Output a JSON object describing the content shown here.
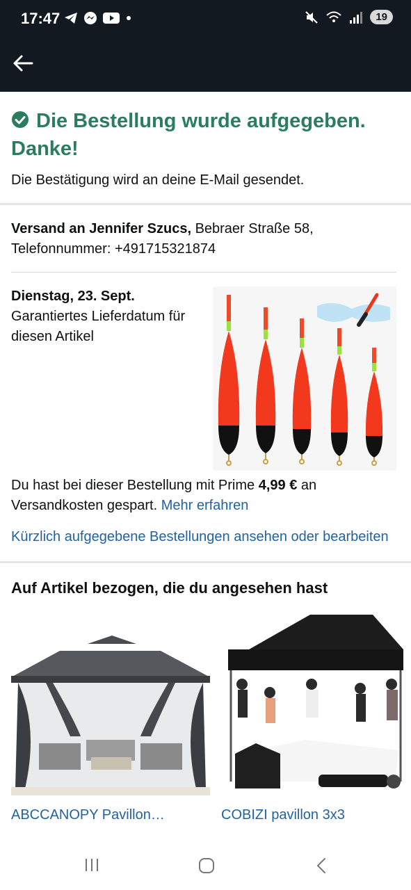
{
  "status_bar": {
    "time": "17:47",
    "left_icons": [
      "telegram-icon",
      "messenger-icon",
      "youtube-icon",
      "dot-icon"
    ],
    "right_icons": [
      "mute-icon",
      "wifi-icon",
      "signal-icon"
    ],
    "battery": "19"
  },
  "confirmation": {
    "title": "Die Bestellung wurde aufgegeben. Danke!",
    "subtitle": "Die Bestätigung wird an deine E-Mail gesendet.",
    "accent_color": "#2a7d5f"
  },
  "shipping": {
    "name_label": "Versand an Jennifer Szucs,",
    "address": "Bebraer Straße 58,",
    "phone": "Telefonnummer: +491715321874"
  },
  "delivery": {
    "date": "Dienstag, 23. Sept.",
    "note": "Garantiertes Lieferdatum für diesen Artikel",
    "image_icon": "fishing-floats-product-image"
  },
  "prime": {
    "text_before": "Du hast bei dieser Bestellung mit Prime ",
    "amount": "4,99 €",
    "text_after": " an Versandkosten gespart. ",
    "link": "Mehr erfahren"
  },
  "recent_orders_link": "Kürzlich aufgegebene Bestellungen ansehen oder bearbeiten",
  "related": {
    "title": "Auf Artikel bezogen, die du angesehen hast",
    "items": [
      {
        "label": "ABCCANOPY Pavillon…",
        "image_icon": "gazebo-image"
      },
      {
        "label": "COBIZI pavillon 3x3",
        "image_icon": "pop-up-tent-image"
      }
    ]
  },
  "link_color": "#2162a1"
}
